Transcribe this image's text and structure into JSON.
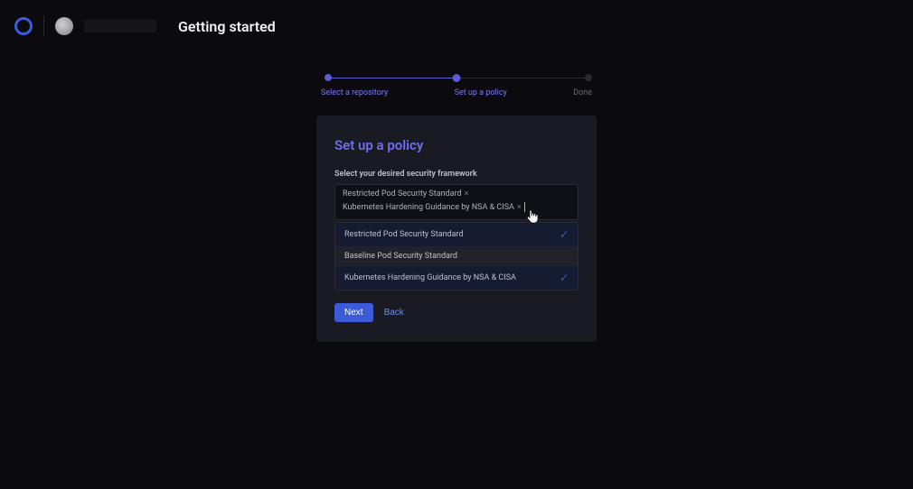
{
  "header": {
    "page_title": "Getting started"
  },
  "stepper": {
    "steps": [
      {
        "label": "Select a repository",
        "state": "done"
      },
      {
        "label": "Set up a policy",
        "state": "active"
      },
      {
        "label": "Done",
        "state": "pending"
      }
    ]
  },
  "card": {
    "title": "Set up a policy",
    "field_label": "Select your desired security framework",
    "selected_chips": [
      "Restricted Pod Security Standard",
      "Kubernetes Hardening Guidance by NSA & CISA"
    ],
    "options": [
      {
        "label": "Restricted Pod Security Standard",
        "selected": true,
        "hovered": false
      },
      {
        "label": "Baseline Pod Security Standard",
        "selected": false,
        "hovered": true
      },
      {
        "label": "Kubernetes Hardening Guidance by NSA & CISA",
        "selected": true,
        "hovered": false
      }
    ],
    "next_button": "Next",
    "back_button": "Back"
  }
}
